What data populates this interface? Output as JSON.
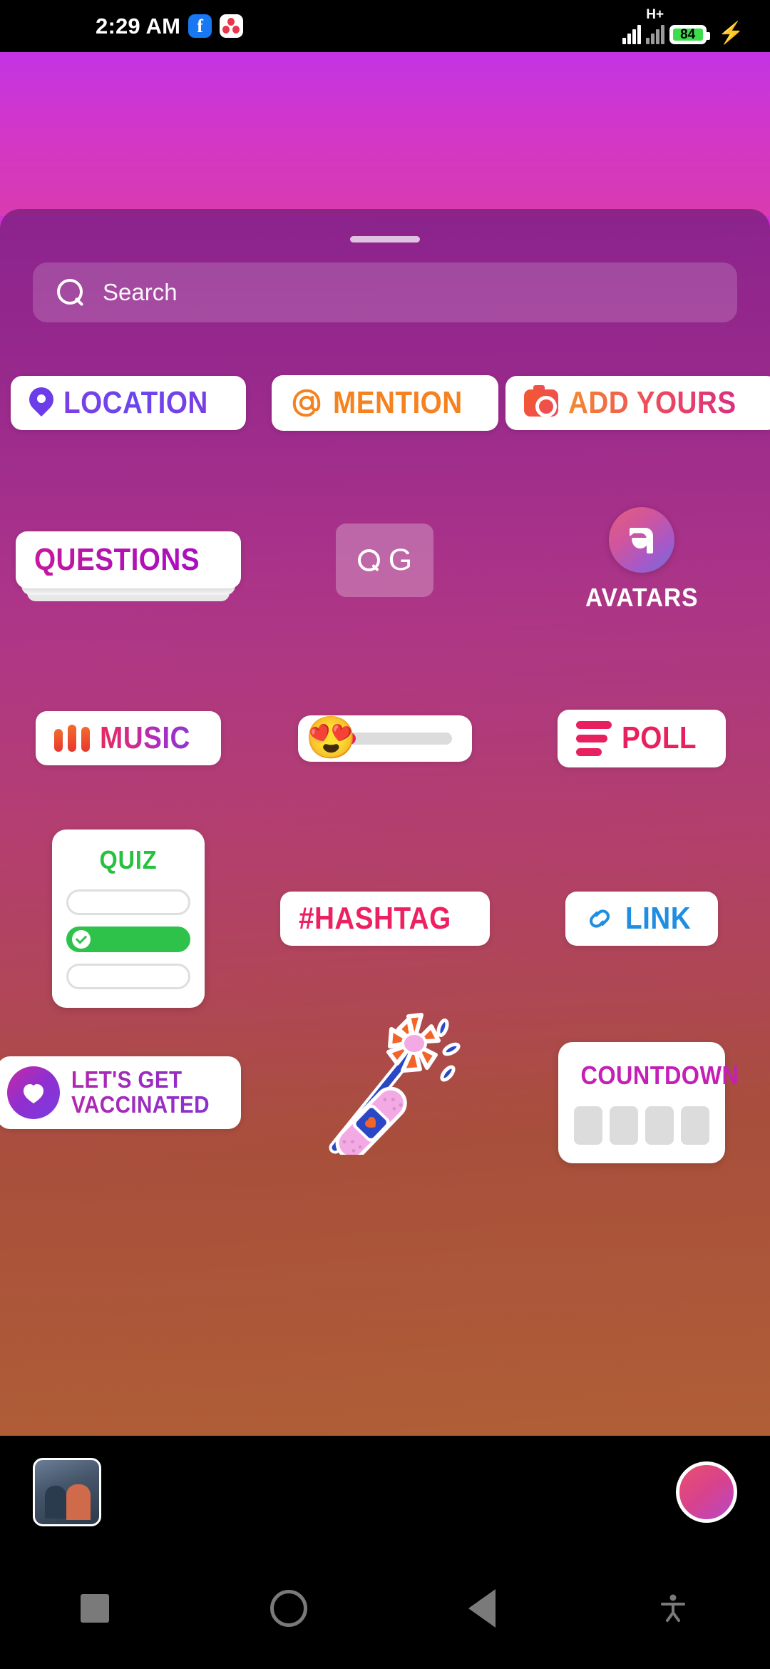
{
  "status_bar": {
    "time": "2:29 AM",
    "facebook_icon": "facebook-icon",
    "app_icon": "dots-app-icon",
    "network_label": "H+",
    "battery_percent": "84",
    "charging_icon": "charging-bolt-icon"
  },
  "sheet": {
    "handle": "drag-handle",
    "search": {
      "placeholder": "Search",
      "icon": "search-icon"
    }
  },
  "stickers": {
    "row1": [
      {
        "id": "location",
        "label": "LOCATION",
        "icon": "location-pin-icon",
        "color": "#6b3ce8"
      },
      {
        "id": "mention",
        "label": "MENTION",
        "icon": "at-mention-icon",
        "color": "#f5821f"
      },
      {
        "id": "add_yours",
        "label": "ADD YOURS",
        "icon": "camera-icon",
        "color": "#ee4b5c"
      }
    ],
    "row2": [
      {
        "id": "questions",
        "label": "QUESTIONS",
        "color": "#b312b0"
      },
      {
        "id": "gif",
        "label": "G",
        "icon": "gif-search-icon"
      },
      {
        "id": "avatars",
        "label": "AVATARS",
        "icon": "avatar-face-icon"
      }
    ],
    "row3": [
      {
        "id": "music",
        "label": "MUSIC",
        "icon": "music-bars-icon",
        "color": "#d32b86"
      },
      {
        "id": "emoji_slider",
        "label": "",
        "icon": "heart-eyes-emoji",
        "emoji": "😍",
        "fill_percent": 28
      },
      {
        "id": "poll",
        "label": "POLL",
        "icon": "poll-bars-icon",
        "color": "#e8205f"
      }
    ],
    "row4": [
      {
        "id": "quiz",
        "label": "QUIZ",
        "color": "#27c13f",
        "options": 3,
        "selected_index": 1
      },
      {
        "id": "hashtag",
        "label": "#HASHTAG",
        "color": "#ed2061"
      },
      {
        "id": "link",
        "label": "LINK",
        "icon": "chain-link-icon",
        "color": "#1f8ee0"
      }
    ],
    "row5": [
      {
        "id": "vaccinated",
        "label_line1": "LET'S GET",
        "label_line2": "VACCINATED",
        "icon": "heart-shield-icon",
        "color": "#8a30cf"
      },
      {
        "id": "flower_bandage",
        "label": "",
        "icon": "flower-bandage-sticker"
      },
      {
        "id": "countdown",
        "label": "COUNTDOWN",
        "color": "#c41fb6",
        "digit_boxes": 4
      }
    ]
  },
  "bottom_bar": {
    "gallery_thumbnail": "gallery-thumbnail",
    "shutter": "shutter-button"
  },
  "nav_bar": {
    "recents": "recents-square-icon",
    "home": "home-circle-icon",
    "back": "back-triangle-icon",
    "accessibility": "accessibility-icon"
  }
}
